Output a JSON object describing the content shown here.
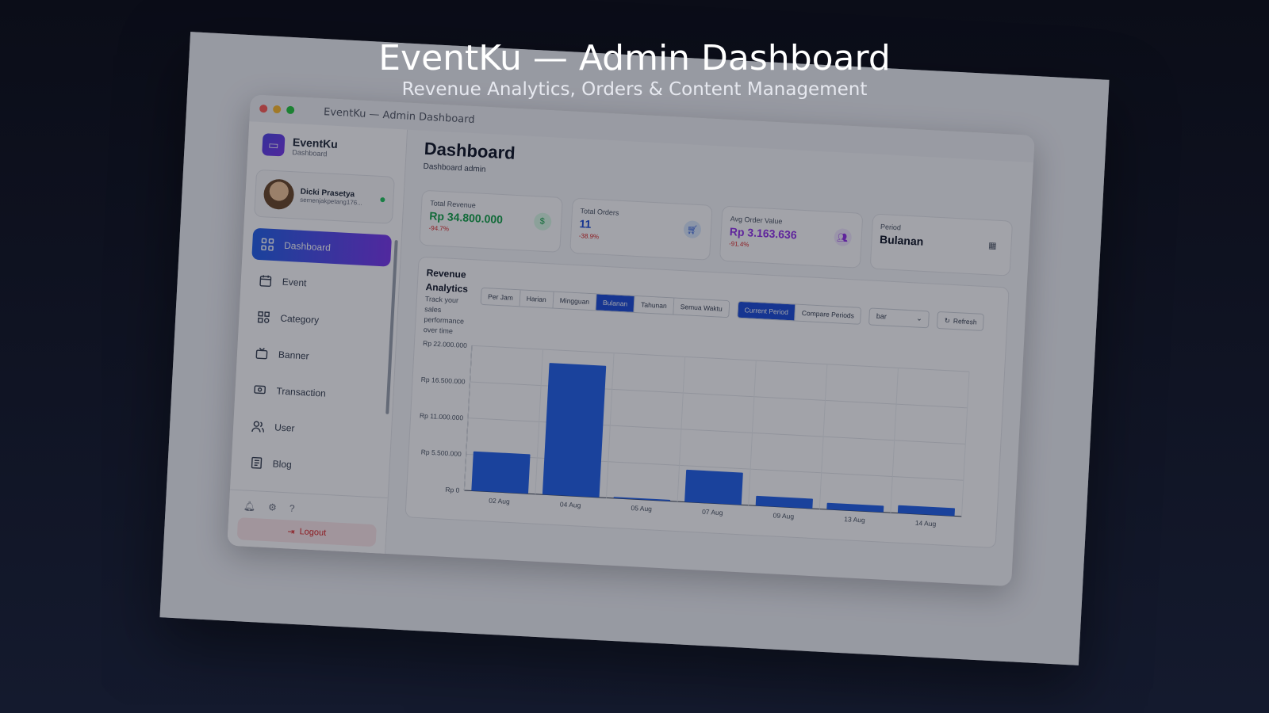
{
  "hero": {
    "title": "EventKu — Admin Dashboard",
    "subtitle": "Revenue Analytics, Orders & Content Management"
  },
  "window": {
    "title": "EventKu — Admin Dashboard"
  },
  "brand": {
    "name": "EventKu",
    "sub": "Dashboard"
  },
  "profile": {
    "name": "Dicki Prasetya",
    "email": "semenjakpetang176..."
  },
  "sidebar": {
    "items": [
      {
        "label": "Dashboard",
        "icon": "grid-icon",
        "active": true
      },
      {
        "label": "Event",
        "icon": "calendar-icon"
      },
      {
        "label": "Category",
        "icon": "category-icon"
      },
      {
        "label": "Banner",
        "icon": "tv-icon"
      },
      {
        "label": "Transaction",
        "icon": "transaction-icon"
      },
      {
        "label": "User",
        "icon": "users-icon"
      },
      {
        "label": "Blog",
        "icon": "blog-icon"
      }
    ],
    "logout": "Logout"
  },
  "main": {
    "title": "Dashboard",
    "subtitle": "Dashboard admin"
  },
  "stats": {
    "revenue": {
      "label": "Total Revenue",
      "value": "Rp 34.800.000",
      "change": "-94.7%",
      "color": "#16a34a"
    },
    "orders": {
      "label": "Total Orders",
      "value": "11",
      "change": "-38.9%",
      "color": "#1d4ed8"
    },
    "aov": {
      "label": "Avg Order Value",
      "value": "Rp 3.163.636",
      "change": "-91.4%",
      "color": "#9333ea"
    },
    "period": {
      "label": "Period",
      "value": "Bulanan"
    }
  },
  "analytics": {
    "title": "Revenue Analytics",
    "desc": "Track your sales performance over time",
    "granularity": [
      "Per Jam",
      "Harian",
      "Mingguan",
      "Bulanan",
      "Tahunan",
      "Semua Waktu"
    ],
    "granularity_selected": "Bulanan",
    "compare": [
      "Current Period",
      "Compare Periods"
    ],
    "compare_selected": "Current Period",
    "chart_type": "bar",
    "refresh": "Refresh"
  },
  "chart_data": {
    "type": "bar",
    "categories": [
      "02 Aug",
      "04 Aug",
      "05 Aug",
      "07 Aug",
      "09 Aug",
      "13 Aug",
      "14 Aug"
    ],
    "values": [
      6000000,
      20000000,
      200000,
      4900000,
      1500000,
      1000000,
      1200000
    ],
    "ylim": [
      0,
      22000000
    ],
    "yticks": [
      "Rp 0",
      "Rp 5.500.000",
      "Rp 11.000.000",
      "Rp 16.500.000",
      "Rp 22.000.000"
    ],
    "bar_color": "#2563eb",
    "grid": true
  }
}
